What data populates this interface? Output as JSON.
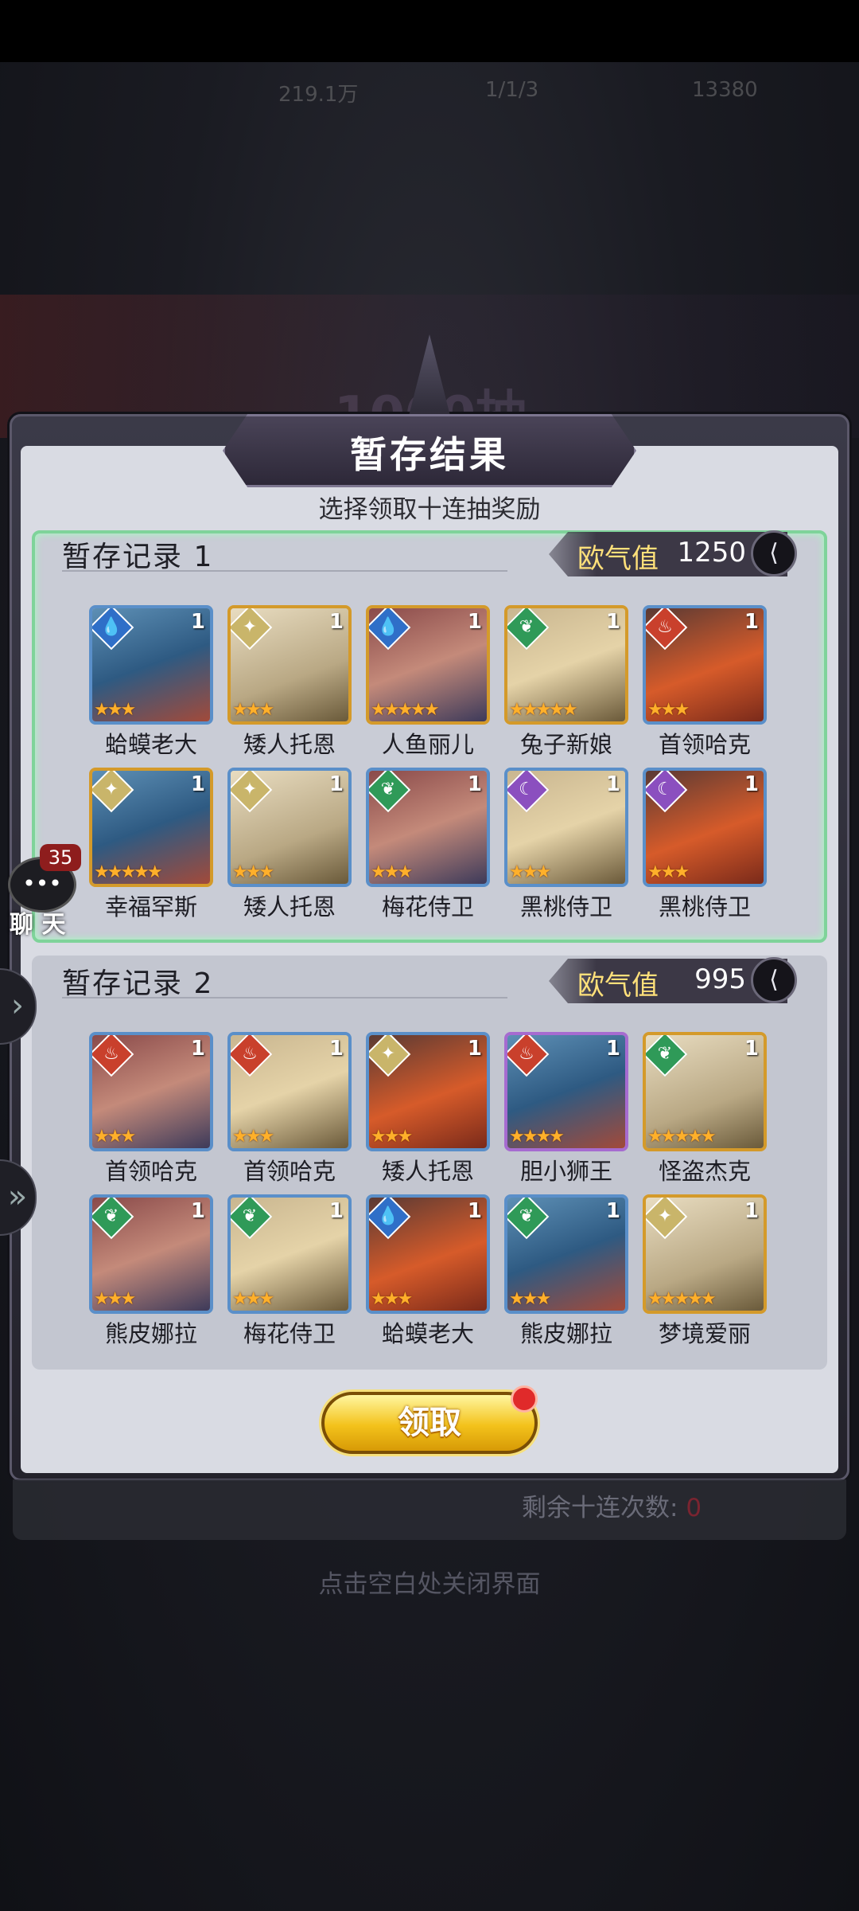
{
  "hud": {
    "power": "219.1万",
    "stamina": "1/1/3",
    "gems": "13380"
  },
  "banner": {
    "text": "1000抽"
  },
  "dialog": {
    "title": "暂存结果",
    "subtitle": "选择领取十连抽奖励",
    "claim_label": "领取"
  },
  "records": [
    {
      "title": "暂存记录 1",
      "luck_label": "欧气值",
      "luck_value": "1250",
      "cards": [
        {
          "name": "蛤蟆老大",
          "level": "1",
          "stars": 3,
          "element": "water",
          "frame": "blue"
        },
        {
          "name": "矮人托恩",
          "level": "1",
          "stars": 3,
          "element": "light",
          "frame": "gold"
        },
        {
          "name": "人鱼丽儿",
          "level": "1",
          "stars": 5,
          "element": "water",
          "frame": "gold"
        },
        {
          "name": "兔子新娘",
          "level": "1",
          "stars": 5,
          "element": "wind",
          "frame": "gold"
        },
        {
          "name": "首领哈克",
          "level": "1",
          "stars": 3,
          "element": "fire",
          "frame": "blue"
        },
        {
          "name": "幸福罕斯",
          "level": "1",
          "stars": 5,
          "element": "light",
          "frame": "gold"
        },
        {
          "name": "矮人托恩",
          "level": "1",
          "stars": 3,
          "element": "light",
          "frame": "blue"
        },
        {
          "name": "梅花侍卫",
          "level": "1",
          "stars": 3,
          "element": "wind",
          "frame": "blue"
        },
        {
          "name": "黑桃侍卫",
          "level": "1",
          "stars": 3,
          "element": "dark",
          "frame": "blue"
        },
        {
          "name": "黑桃侍卫",
          "level": "1",
          "stars": 3,
          "element": "dark",
          "frame": "blue"
        }
      ]
    },
    {
      "title": "暂存记录 2",
      "luck_label": "欧气值",
      "luck_value": "995",
      "cards": [
        {
          "name": "首领哈克",
          "level": "1",
          "stars": 3,
          "element": "fire",
          "frame": "blue"
        },
        {
          "name": "首领哈克",
          "level": "1",
          "stars": 3,
          "element": "fire",
          "frame": "blue"
        },
        {
          "name": "矮人托恩",
          "level": "1",
          "stars": 3,
          "element": "light",
          "frame": "blue"
        },
        {
          "name": "胆小狮王",
          "level": "1",
          "stars": 4,
          "element": "fire",
          "frame": "purple"
        },
        {
          "name": "怪盗杰克",
          "level": "1",
          "stars": 5,
          "element": "wind",
          "frame": "gold"
        },
        {
          "name": "熊皮娜拉",
          "level": "1",
          "stars": 3,
          "element": "wind",
          "frame": "blue"
        },
        {
          "name": "梅花侍卫",
          "level": "1",
          "stars": 3,
          "element": "wind",
          "frame": "blue"
        },
        {
          "name": "蛤蟆老大",
          "level": "1",
          "stars": 3,
          "element": "water",
          "frame": "blue"
        },
        {
          "name": "熊皮娜拉",
          "level": "1",
          "stars": 3,
          "element": "wind",
          "frame": "blue"
        },
        {
          "name": "梦境爱丽",
          "level": "1",
          "stars": 5,
          "element": "light",
          "frame": "gold"
        }
      ]
    }
  ],
  "remaining": {
    "label": "剩余十连次数:",
    "value": "0"
  },
  "close_hint": "点击空白处关闭界面",
  "chat": {
    "label": "聊 天",
    "badge": "35"
  },
  "colors": {
    "accent_gold": "#f3c21b",
    "luck_label": "#ffe07a",
    "selected_border": "#7fd39a",
    "fire": "#c9402c",
    "water": "#2f6fc8",
    "light": "#c9b56a",
    "wind": "#2f9a58",
    "dark": "#8b4fbf"
  }
}
